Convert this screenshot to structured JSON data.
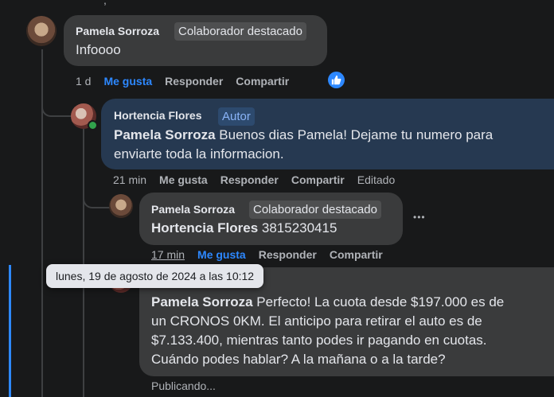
{
  "comments": [
    {
      "author": "Pamela Sorroza",
      "badge": "Colaborador destacado",
      "text": "Infoooo",
      "time": "1 d",
      "like": "Me gusta",
      "reply": "Responder",
      "share": "Compartir"
    },
    {
      "author": "Hortencia Flores",
      "badge": "Autor",
      "mention": "Pamela Sorroza",
      "text_line1": " Buenos dias Pamela! Dejame tu numero para",
      "text_line2": "enviarte toda la informacion.",
      "time": "21 min",
      "like": "Me gusta",
      "reply": "Responder",
      "share": "Compartir",
      "edited": "Editado"
    },
    {
      "author": "Pamela Sorroza",
      "badge": "Colaborador destacado",
      "mention": "Hortencia Flores",
      "text": " 3815230415",
      "time": "17 min",
      "like": "Me gusta",
      "reply": "Responder",
      "share": "Compartir",
      "more": "•••"
    },
    {
      "mention": "Pamela Sorroza",
      "text_line1": " Perfecto! La cuota desde $197.000 es de",
      "text_line2": "un CRONOS 0KM. El anticipo para retirar el auto es de",
      "text_line3": "$7.133.400, mientras tanto podes ir pagando en cuotas.",
      "text_line4": "Cuándo podes hablar? A la mañana o a la tarde?",
      "status": "Publicando..."
    }
  ],
  "tooltip": "lunes, 19 de agosto de 2024 a las 10:12",
  "colors": {
    "accent": "#2d88ff",
    "bubble": "#3a3b3c",
    "author_bubble": "#263951",
    "background": "#18191a"
  }
}
